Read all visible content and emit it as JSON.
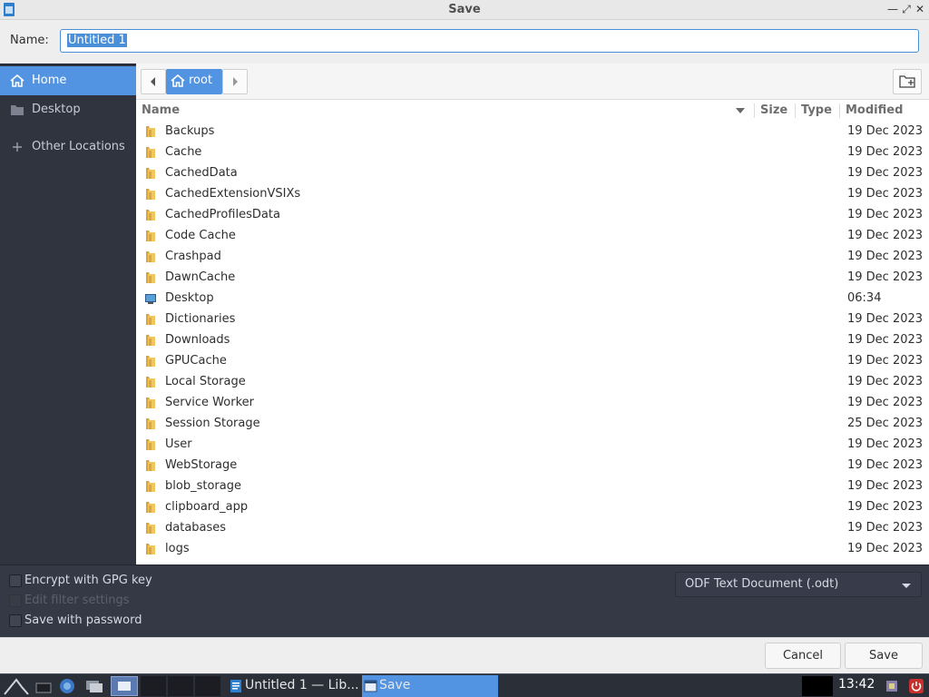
{
  "window": {
    "title": "Save"
  },
  "name_field": {
    "label": "Name:",
    "value": "Untitled 1"
  },
  "sidebar": {
    "items": [
      {
        "label": "Home",
        "icon": "home-icon",
        "active": true
      },
      {
        "label": "Desktop",
        "icon": "folder-icon",
        "active": false
      },
      {
        "label": "Other Locations",
        "icon": "plus-icon",
        "active": false
      }
    ]
  },
  "pathbar": {
    "current": "root"
  },
  "columns": {
    "name": "Name",
    "size": "Size",
    "type": "Type",
    "modified": "Modified"
  },
  "files": [
    {
      "name": "Backups",
      "modified": "19 Dec 2023"
    },
    {
      "name": "Cache",
      "modified": "19 Dec 2023"
    },
    {
      "name": "CachedData",
      "modified": "19 Dec 2023"
    },
    {
      "name": "CachedExtensionVSIXs",
      "modified": "19 Dec 2023"
    },
    {
      "name": "CachedProfilesData",
      "modified": "19 Dec 2023"
    },
    {
      "name": "Code Cache",
      "modified": "19 Dec 2023"
    },
    {
      "name": "Crashpad",
      "modified": "19 Dec 2023"
    },
    {
      "name": "DawnCache",
      "modified": "19 Dec 2023"
    },
    {
      "name": "Desktop",
      "modified": "06:34",
      "icon": "desktop-icon"
    },
    {
      "name": "Dictionaries",
      "modified": "19 Dec 2023"
    },
    {
      "name": "Downloads",
      "modified": "19 Dec 2023"
    },
    {
      "name": "GPUCache",
      "modified": "19 Dec 2023"
    },
    {
      "name": "Local Storage",
      "modified": "19 Dec 2023"
    },
    {
      "name": "Service Worker",
      "modified": "19 Dec 2023"
    },
    {
      "name": "Session Storage",
      "modified": "25 Dec 2023"
    },
    {
      "name": "User",
      "modified": "19 Dec 2023"
    },
    {
      "name": "WebStorage",
      "modified": "19 Dec 2023"
    },
    {
      "name": "blob_storage",
      "modified": "19 Dec 2023"
    },
    {
      "name": "clipboard_app",
      "modified": "19 Dec 2023"
    },
    {
      "name": "databases",
      "modified": "19 Dec 2023"
    },
    {
      "name": "logs",
      "modified": "19 Dec 2023"
    }
  ],
  "options": {
    "encrypt": "Encrypt with GPG key",
    "edit_filter": "Edit filter settings",
    "save_password": "Save with password",
    "filetype": "ODF Text Document (.odt)"
  },
  "buttons": {
    "cancel": "Cancel",
    "save": "Save"
  },
  "taskbar": {
    "tasks": [
      {
        "label": "Untitled 1 — Lib...",
        "icon": "writer-icon",
        "active": false
      },
      {
        "label": "Save",
        "icon": "dialog-icon",
        "active": true
      }
    ],
    "clock": "13:42"
  },
  "colors": {
    "accent": "#5294e2",
    "sidebar_bg": "#2f343f",
    "options_bg": "#353945",
    "folder": "#d9a53a"
  }
}
